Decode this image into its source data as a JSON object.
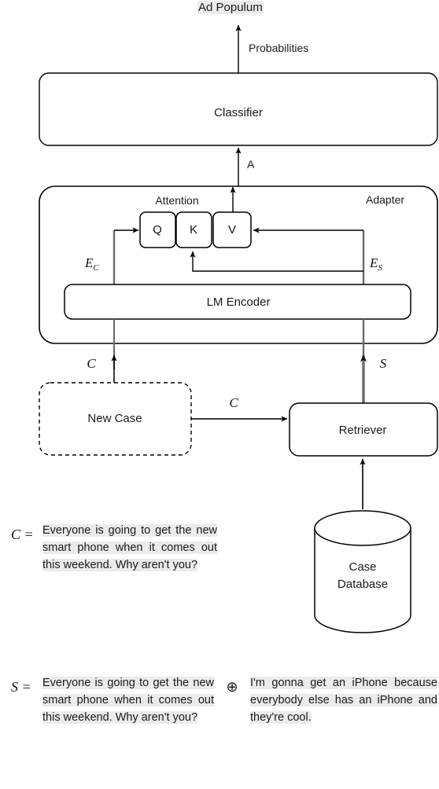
{
  "figure": {
    "type": "architecture-diagram",
    "title_output": "Ad Populum"
  },
  "nodes": {
    "output_label": "Ad Populum",
    "classifier": "Classifier",
    "adapter": "Adapter",
    "attention": "Attention",
    "q": "Q",
    "k": "K",
    "v": "V",
    "lm_encoder": "LM Encoder",
    "new_case": "New Case",
    "retriever": "Retriever",
    "case_database_line1": "Case",
    "case_database_line2": "Database"
  },
  "edges": {
    "probabilities": "Probabilities",
    "a": "A",
    "e_c_base": "E",
    "e_c_sub": "C",
    "e_s_base": "E",
    "e_s_sub": "S",
    "c_into_adapter": "C",
    "s_into_adapter": "S",
    "c_to_retriever": "C"
  },
  "equations": {
    "c": {
      "symbol": "C =",
      "text": "Everyone is going to get the new smart phone when it comes out this weekend. Why aren't you?"
    },
    "s": {
      "symbol": "S =",
      "operator": "⊕",
      "left_text": "Everyone is going to get the new smart phone when it comes out this weekend. Why aren't you?",
      "right_text": "I'm gonna get an iPhone because everybody else has an iPhone and they're cool."
    }
  },
  "colors": {
    "stroke": "#000000",
    "gray_stroke": "#6b6b6b",
    "highlight": "#ebebeb",
    "background": "#ffffff"
  }
}
